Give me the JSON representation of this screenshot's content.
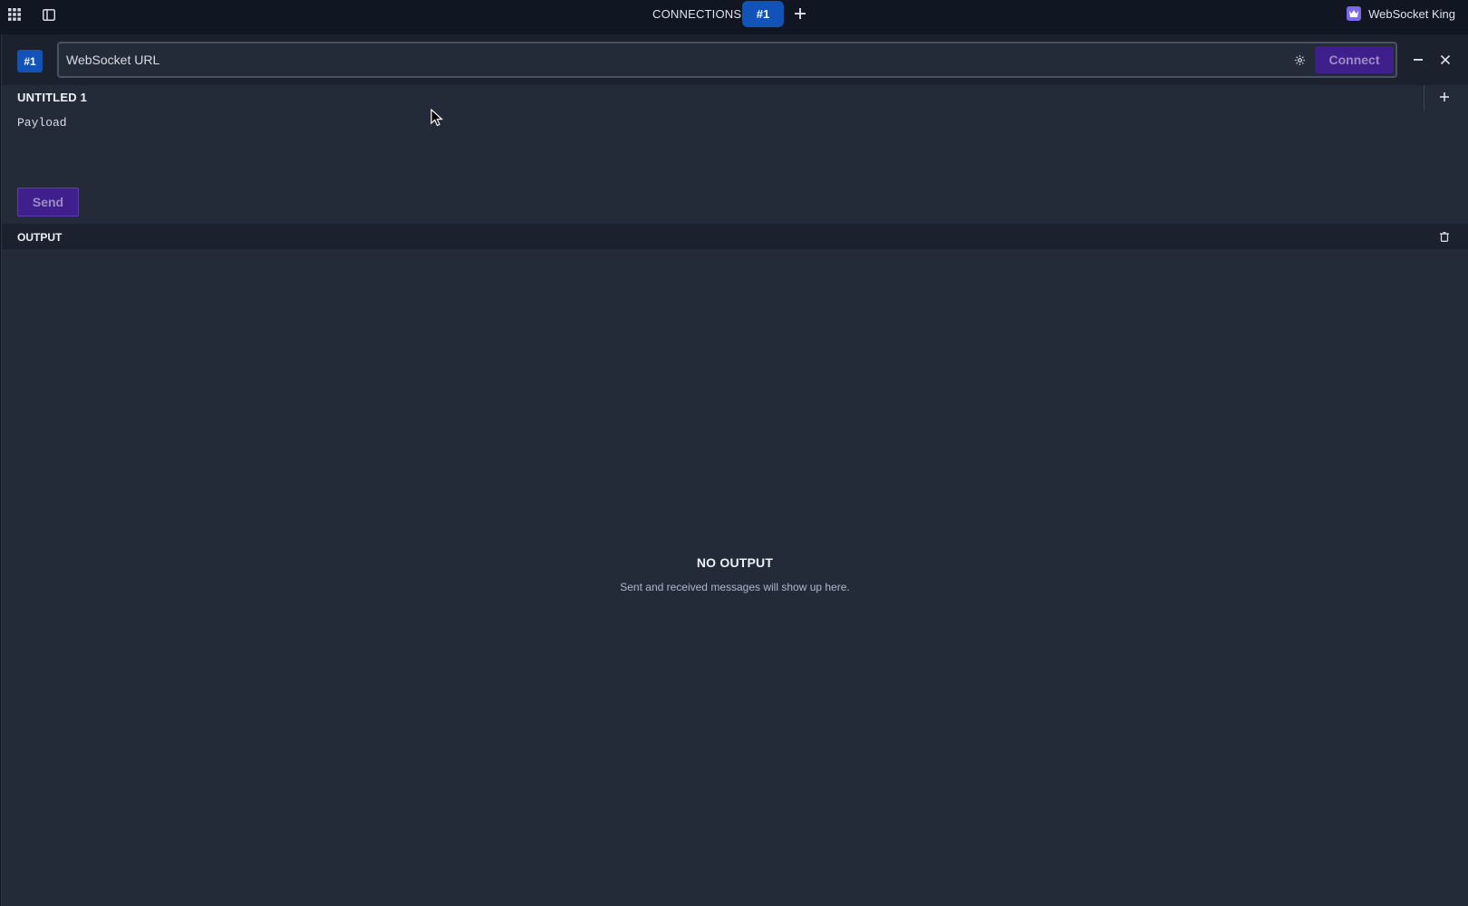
{
  "topbar": {
    "connections_label": "CONNECTIONS",
    "active_tab_label": "#1",
    "add_tab_icon": "plus-icon",
    "apps_icon": "grid-icon",
    "sidebar_icon": "sidebar-toggle-icon",
    "brand_name": "WebSocket King",
    "brand_logo_icon": "crown-icon"
  },
  "connection": {
    "badge": "#1",
    "url_placeholder": "WebSocket URL",
    "url_value": "",
    "settings_icon": "gear-icon",
    "connect_label": "Connect",
    "minimize_icon": "minus-icon",
    "close_icon": "close-icon"
  },
  "message": {
    "title": "UNTITLED 1",
    "add_icon": "plus-icon",
    "payload_placeholder": "Payload",
    "payload_value": "",
    "send_label": "Send"
  },
  "output": {
    "label": "OUTPUT",
    "clear_icon": "trash-icon",
    "empty_title": "NO OUTPUT",
    "empty_subtitle": "Sent and received messages will show up here."
  },
  "colors": {
    "accent_blue": "#1153b8",
    "button_purple": "#3e1f8b",
    "panel_bg": "#232a38",
    "bar_bg": "#1b212d",
    "top_bg": "#101622"
  }
}
